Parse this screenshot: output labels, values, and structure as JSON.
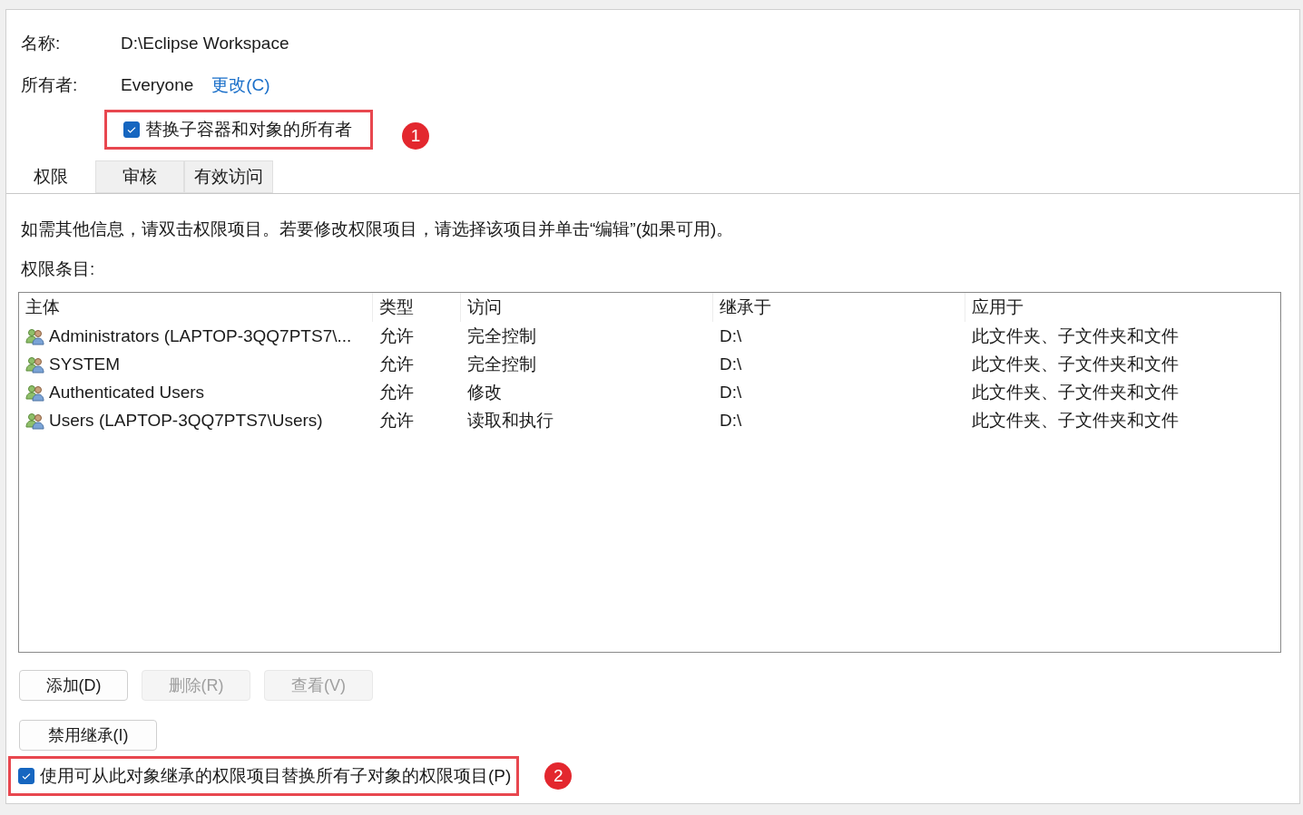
{
  "fields": [
    {
      "label": "名称:",
      "value": "D:\\Eclipse Workspace"
    },
    {
      "label": "所有者:",
      "value": "Everyone",
      "link": "更改(C)"
    }
  ],
  "owner_checkbox": {
    "label": "替换子容器和对象的所有者",
    "checked": true,
    "highlighted": true,
    "badge": "1"
  },
  "tabs": [
    {
      "label": "权限",
      "selected": true
    },
    {
      "label": "审核",
      "selected": false
    },
    {
      "label": "有效访问",
      "selected": false
    }
  ],
  "info_text": "如需其他信息，请双击权限项目。若要修改权限项目，请选择该项目并单击“编辑”(如果可用)。",
  "list_label": "权限条目:",
  "table": {
    "columns": [
      "主体",
      "类型",
      "访问",
      "继承于",
      "应用于"
    ],
    "rows": [
      [
        "Administrators (LAPTOP-3QQ7PTS7\\...",
        "允许",
        "完全控制",
        "D:\\",
        "此文件夹、子文件夹和文件"
      ],
      [
        "SYSTEM",
        "允许",
        "完全控制",
        "D:\\",
        "此文件夹、子文件夹和文件"
      ],
      [
        "Authenticated Users",
        "允许",
        "修改",
        "D:\\",
        "此文件夹、子文件夹和文件"
      ],
      [
        "Users (LAPTOP-3QQ7PTS7\\Users)",
        "允许",
        "读取和执行",
        "D:\\",
        "此文件夹、子文件夹和文件"
      ]
    ]
  },
  "buttons": [
    {
      "label": "添加(D)",
      "disabled": false
    },
    {
      "label": "删除(R)",
      "disabled": true
    },
    {
      "label": "查看(V)",
      "disabled": true
    }
  ],
  "inherit_button": {
    "label": "禁用继承(I)",
    "disabled": false
  },
  "replace_checkbox": {
    "label": "使用可从此对象继承的权限项目替换所有子对象的权限项目(P)",
    "checked": true,
    "highlighted": true,
    "badge": "2"
  }
}
